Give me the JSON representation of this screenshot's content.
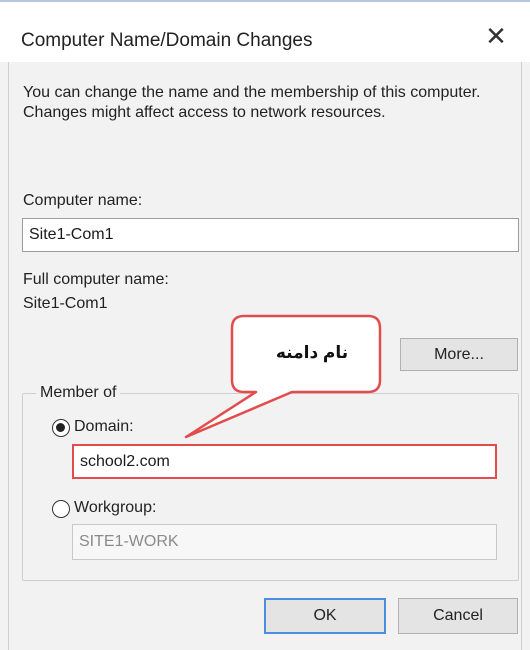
{
  "window": {
    "title": "Computer Name/Domain Changes",
    "close_glyph": "✕"
  },
  "description": "You can change the name and the membership of this computer. Changes might affect access to network resources.",
  "computer_name": {
    "label": "Computer name:",
    "value": "Site1-Com1"
  },
  "full_computer_name": {
    "label": "Full computer name:",
    "value": "Site1-Com1"
  },
  "more_button": "More...",
  "callout": {
    "text": "نام دامنه",
    "color": "#e34c4c"
  },
  "member_of": {
    "label": "Member of",
    "domain": {
      "label": "Domain:",
      "value": "school2.com",
      "selected": true
    },
    "workgroup": {
      "label": "Workgroup:",
      "value": "SITE1-WORK",
      "selected": false
    }
  },
  "buttons": {
    "ok": "OK",
    "cancel": "Cancel"
  }
}
